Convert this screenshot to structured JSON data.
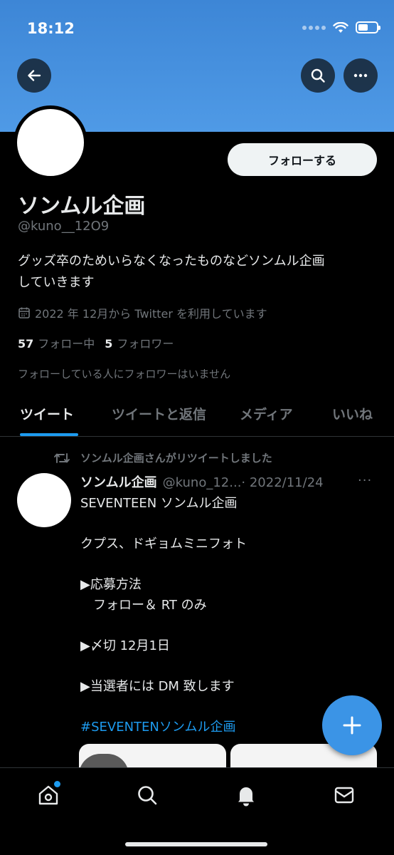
{
  "status_bar": {
    "time": "18:12"
  },
  "profile": {
    "follow_label": "フォローする",
    "name": "ソンムル企画",
    "handle": "@kuno__12O9",
    "bio_line1": "グッズ卒のためいらなくなったものなどソンムル企画",
    "bio_line2": "していきます",
    "joined": "2022 年 12月から Twitter を利用しています",
    "following_count": "57",
    "following_label": "フォロー中",
    "followers_count": "5",
    "followers_label": "フォロワー",
    "no_followers_text": "フォローしている人にフォロワーはいません"
  },
  "tabs": [
    {
      "label": "ツイート",
      "active": true
    },
    {
      "label": "ツイートと返信",
      "active": false
    },
    {
      "label": "メディア",
      "active": false
    },
    {
      "label": "いいね",
      "active": false
    }
  ],
  "tweet": {
    "retweet_context": "ソンムル企画さんがリツイートしました",
    "author": "ソンムル企画",
    "handle_date": "@kuno_12...· 2022/11/24",
    "more": "···",
    "lines": [
      "SEVENTEEN ソンムル企画",
      "クプス、ドギョムミニフォト",
      "▶応募方法",
      "　フォロー＆ RT のみ",
      "▶〆切  12月1日",
      "▶当選者には DM 致します"
    ],
    "hashtag": "#SEVENTENソンムル企画"
  },
  "icons": {
    "back": "arrow-left-icon",
    "search": "search-icon",
    "more": "more-horizontal-icon",
    "calendar": "calendar-icon",
    "retweet": "retweet-icon",
    "compose": "plus-icon",
    "home": "home-icon",
    "explore": "search-icon",
    "notifications": "bell-icon",
    "messages": "mail-icon"
  },
  "colors": {
    "accent": "#1d9bf0",
    "banner": "#4a95e2",
    "background": "#000000"
  }
}
